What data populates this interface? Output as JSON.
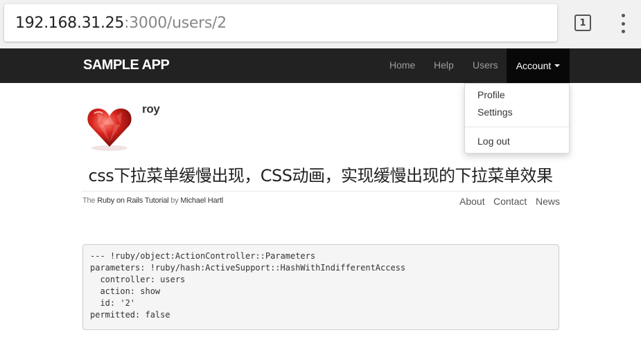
{
  "browser": {
    "url_host": "192.168.31.25",
    "url_path": ":3000/users/2",
    "tab_count": "1",
    "menu_icon": "more-vertical-icon"
  },
  "navbar": {
    "brand": "SAMPLE APP",
    "links": [
      "Home",
      "Help",
      "Users"
    ],
    "account_label": "Account",
    "background": "#222222"
  },
  "dropdown": {
    "items": [
      "Profile",
      "Settings"
    ],
    "logout": "Log out"
  },
  "user": {
    "name": "roy",
    "avatar_icon": "heart-gem-icon"
  },
  "caption": "css下拉菜单缓慢出现，CSS动画，实现缓慢出现的下拉菜单效果",
  "footer": {
    "text_prefix": "The ",
    "text_link1": "Ruby on Rails Tutorial",
    "text_middle": " by ",
    "text_link2": "Michael Hartl",
    "links": [
      "About",
      "Contact",
      "News"
    ]
  },
  "debug": {
    "lines": [
      "--- !ruby/object:ActionController::Parameters",
      "parameters: !ruby/hash:ActiveSupport::HashWithIndifferentAccess",
      "  controller: users",
      "  action: show",
      "  id: '2'",
      "permitted: false"
    ]
  }
}
